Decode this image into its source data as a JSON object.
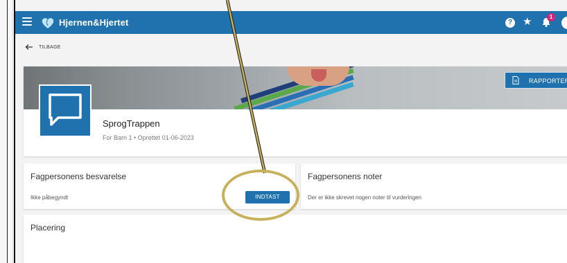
{
  "app": {
    "title": "Hjernen&Hjertet"
  },
  "colors": {
    "primary": "#1f72ad",
    "badge": "#d6247d",
    "highlight_ring": "#c7b15c"
  },
  "header_icons": [
    "help-icon",
    "star-icon",
    "bell-icon",
    "avatar"
  ],
  "notifications": {
    "count": "1"
  },
  "back": {
    "label": "TILBAGE"
  },
  "header": {
    "report_button": "RAPPORTER",
    "title": "SprogTrappen",
    "meta": "For Barn 1  •  Oprettet 01-06-2023"
  },
  "cards": {
    "response": {
      "title": "Fagpersonens besvarelse",
      "status": "Ikke påbegyndt",
      "button": "INDTAST"
    },
    "notes": {
      "title": "Fagpersonens noter",
      "empty_text": "Der er ikke skrevet nogen noter til vurderingen"
    },
    "placement": {
      "title": "Placering"
    }
  }
}
